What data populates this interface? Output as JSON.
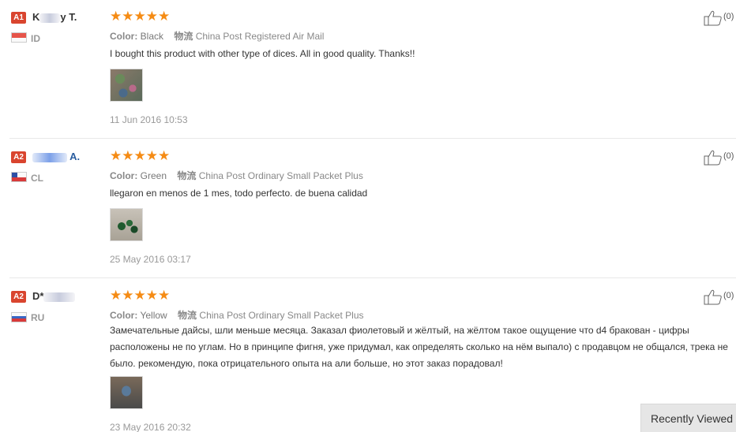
{
  "reviews": [
    {
      "badge": "A1",
      "name_start": "K",
      "name_end": "y T.",
      "country": "ID",
      "stars": "★★★★★",
      "color_label": "Color:",
      "color_value": "Black",
      "shipping_label": "物流",
      "shipping_value": "China Post Registered Air Mail",
      "text": "I bought this product with other type of dices. All in good quality. Thanks!!",
      "date": "11 Jun 2016 10:53",
      "helpful_count": "(0)"
    },
    {
      "badge": "A2",
      "name_start": "",
      "name_end": "A.",
      "country": "CL",
      "stars": "★★★★★",
      "color_label": "Color:",
      "color_value": "Green",
      "shipping_label": "物流",
      "shipping_value": "China Post Ordinary Small Packet Plus",
      "text": "llegaron en menos de 1 mes, todo perfecto. de buena calidad",
      "date": "25 May 2016 03:17",
      "helpful_count": "(0)"
    },
    {
      "badge": "A2",
      "name_start": "D*",
      "name_end": "",
      "country": "RU",
      "stars": "★★★★★",
      "color_label": "Color:",
      "color_value": "Yellow",
      "shipping_label": "物流",
      "shipping_value": "China Post Ordinary Small Packet Plus",
      "text": "Замечательные дайсы, шли меньше месяца. Заказал фиолетовый и жёлтый, на жёлтом такое ощущение что d4 бракован - цифры расположены не по углам. Но в принципе фигня, уже придумал, как определять сколько на нём выпало) с продавцом не общался, трека не было. рекомендую, пока отрицательного опыта на али больше, но этот заказ порадовал!",
      "date": "23 May 2016 20:32",
      "helpful_count": "(0)"
    }
  ],
  "recently_viewed": "Recently Viewed",
  "colors": {
    "star": "#f58b14",
    "badge": "#d9452f",
    "name_link": "#2a5d9f"
  },
  "icons": {
    "helpful": "thumbs-up-icon"
  }
}
